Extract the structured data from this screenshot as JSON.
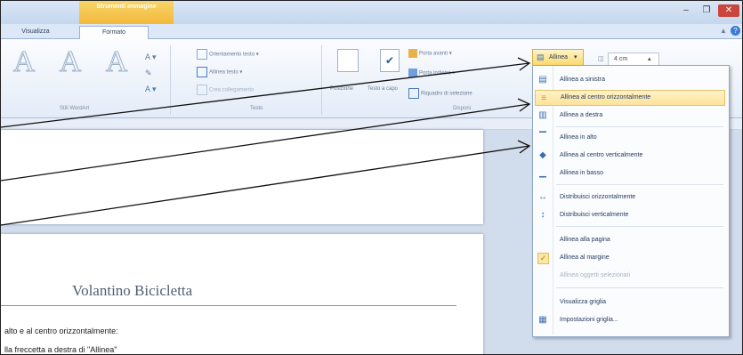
{
  "ribbon": {
    "contextual_group": "Strumenti immagine",
    "tabs": [
      {
        "label": "Visualizza"
      },
      {
        "label": "Formato"
      }
    ],
    "text_group": {
      "direction_label": "Orientamento testo",
      "align_text_label": "Allinea testo",
      "create_link_label": "Crea collegamento",
      "group_label": "Testo"
    },
    "wordart_group_label": "Stili WordArt",
    "arrange_group": {
      "position_label": "Posizione",
      "wrap_label": "Testo a capo",
      "bring_forward_label": "Porta avanti",
      "send_backward_label": "Porta indietro",
      "selection_pane_label": "Riquadro di selezione",
      "group_label": "Disponi"
    },
    "align_button_label": "Allinea",
    "size_value": "4 cm"
  },
  "align_menu": {
    "items": [
      {
        "label": "Allinea a sinistra",
        "icon": "align-left-icon"
      },
      {
        "label": "Allinea al centro orizzontalmente",
        "icon": "align-center-horizontal-icon",
        "highlighted": true
      },
      {
        "label": "Allinea a destra",
        "icon": "align-right-icon"
      },
      {
        "label": "Allinea in alto",
        "icon": "align-top-icon"
      },
      {
        "label": "Allinea al centro verticalmente",
        "icon": "align-middle-icon"
      },
      {
        "label": "Allinea in basso",
        "icon": "align-bottom-icon"
      },
      {
        "label": "Distribuisci orizzontalmente",
        "icon": "distribute-horizontal-icon"
      },
      {
        "label": "Distribuisci verticalmente",
        "icon": "distribute-vertical-icon"
      },
      {
        "label": "Allinea alla pagina"
      },
      {
        "label": "Allinea al margine",
        "checked": true
      },
      {
        "label": "Allinea oggetti selezionati",
        "disabled": true
      },
      {
        "label": "Visualizza griglia"
      },
      {
        "label": "Impostazioni griglia...",
        "icon": "grid-settings-icon"
      }
    ]
  },
  "document": {
    "title": "Volantino Bicicletta",
    "lines": [
      "alto e al centro orizzontalmente:",
      "lla freccetta a destra di \"Allinea\""
    ]
  }
}
